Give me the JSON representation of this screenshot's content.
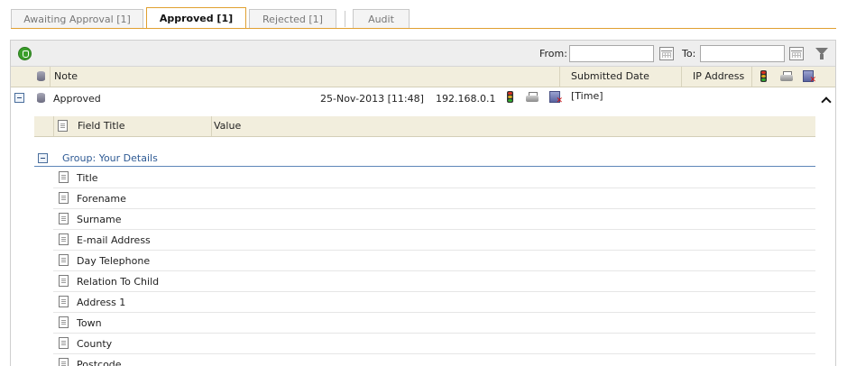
{
  "tabs": [
    {
      "label": "Awaiting Approval [1]",
      "active": false
    },
    {
      "label": "Approved [1]",
      "active": true
    },
    {
      "label": "Rejected [1]",
      "active": false
    },
    {
      "label": "Audit",
      "active": false
    }
  ],
  "toolbar": {
    "from_label": "From:",
    "from_value": "",
    "to_label": "To:",
    "to_value": "",
    "icons": [
      "shield-icon",
      "calendar-icon",
      "filter-icon"
    ]
  },
  "grid": {
    "columns": [
      "Note",
      "Submitted Date [Time]",
      "IP Address"
    ],
    "header_icons": [
      "database-icon",
      "traffic-light-icon",
      "printer-icon",
      "delete-icon"
    ],
    "rows": [
      {
        "note": "Approved",
        "submitted": "25-Nov-2013 [11:48]",
        "ip": "192.168.0.1"
      }
    ]
  },
  "detail": {
    "columns": [
      "Field Title",
      "Value"
    ],
    "group_label": "Group: Your Details",
    "fields": [
      {
        "title": "Title",
        "value": ""
      },
      {
        "title": "Forename",
        "value": ""
      },
      {
        "title": "Surname",
        "value": ""
      },
      {
        "title": "E-mail Address",
        "value": ""
      },
      {
        "title": "Day Telephone",
        "value": ""
      },
      {
        "title": "Relation To Child",
        "value": ""
      },
      {
        "title": "Address 1",
        "value": ""
      },
      {
        "title": "Town",
        "value": ""
      },
      {
        "title": "County",
        "value": ""
      },
      {
        "title": "Postcode",
        "value": ""
      }
    ]
  },
  "colors": {
    "accent": "#e0a030",
    "header_bg": "#f2eedd",
    "group_text": "#2e5a94"
  }
}
